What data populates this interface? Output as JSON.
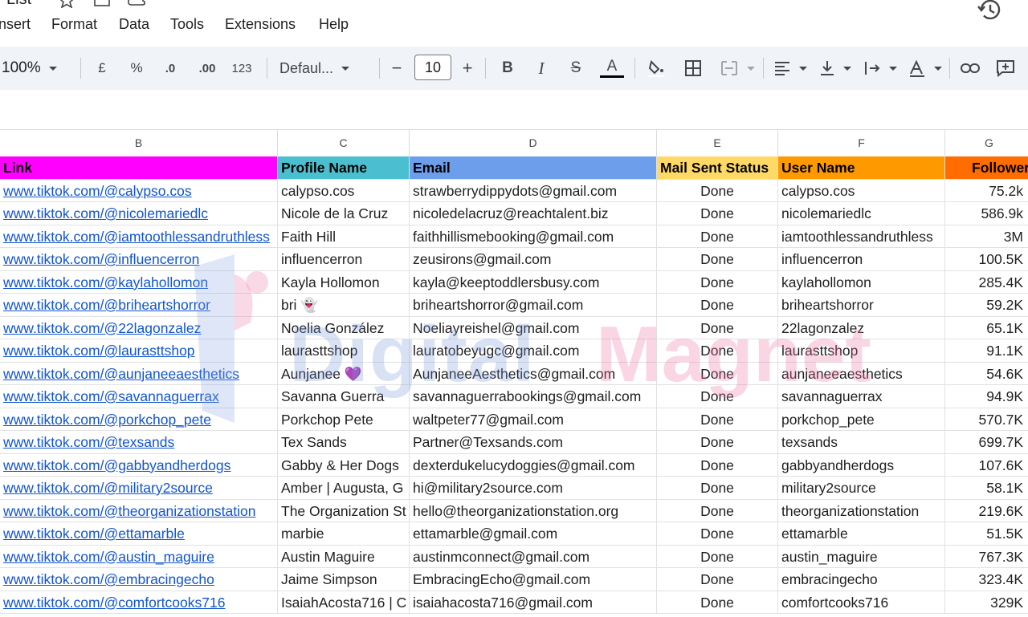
{
  "app": {
    "doc_title_fragment": "List"
  },
  "menu": [
    "nsert",
    "Format",
    "Data",
    "Tools",
    "Extensions",
    "Help"
  ],
  "toolbar": {
    "zoom": "100%",
    "currency": "£",
    "percent": "%",
    "dec_decrease": ".0",
    "dec_increase": ".00",
    "number_format": "123",
    "font": "Defaul...",
    "minus": "−",
    "font_size": "10",
    "plus": "+",
    "bold": "B",
    "italic": "I",
    "strike": "S",
    "text_color": "A"
  },
  "columns": [
    "B",
    "C",
    "D",
    "E",
    "F",
    "G"
  ],
  "header": {
    "link": "Link",
    "profile": "Profile Name",
    "email": "Email",
    "status": "Mail Sent Status",
    "user": "User Name",
    "followers": "Follower"
  },
  "header_colors": {
    "link": "#ff00ff",
    "profile": "#4bbfcf",
    "email": "#6d9eeb",
    "status": "#ffd966",
    "user": "#ff9900",
    "followers": "#ff6d01"
  },
  "rows": [
    {
      "link": "www.tiktok.com/@calypso.cos",
      "profile": "calypso.cos",
      "email": "strawberrydippydots@gmail.com",
      "status": "Done",
      "user": "calypso.cos",
      "followers": "75.2k"
    },
    {
      "link": "www.tiktok.com/@nicolemariedlc",
      "profile": "Nicole de la Cruz",
      "email": " nicoledelacruz@reachtalent.biz",
      "status": "Done",
      "user": "nicolemariedlc",
      "followers": "586.9k"
    },
    {
      "link": "www.tiktok.com/@iamtoothlessandruthless",
      "profile": "Faith Hill",
      "email": "faithhillismebooking@gmail.com",
      "status": "Done",
      "user": "iamtoothlessandruthless",
      "followers": "3M"
    },
    {
      "link": "www.tiktok.com/@influencerron",
      "profile": "influencerron",
      "email": "zeusirons@gmail.com",
      "status": "Done",
      "user": "influencerron",
      "followers": "100.5K"
    },
    {
      "link": "www.tiktok.com/@kaylahollomon",
      "profile": "Kayla Hollomon",
      "email": "kayla@keeptoddlersbusy.com",
      "status": "Done",
      "user": "kaylahollomon",
      "followers": "285.4K"
    },
    {
      "link": "www.tiktok.com/@briheartshorror",
      "profile": "bri 👻",
      "email": "briheartshorror@gmail.com",
      "status": "Done",
      "user": "briheartshorror",
      "followers": "59.2K"
    },
    {
      "link": "www.tiktok.com/@22lagonzalez",
      "profile": "Noelia González",
      "email": " Noeliayreishel@gmail.com",
      "status": "Done",
      "user": "22lagonzalez",
      "followers": "65.1K"
    },
    {
      "link": "www.tiktok.com/@laurasttshop",
      "profile": "laurasttshop",
      "email": "lauratobeyugc@gmail.com",
      "status": "Done",
      "user": "laurasttshop",
      "followers": "91.1K"
    },
    {
      "link": "www.tiktok.com/@aunjaneeaesthetics",
      "profile": "Aunjanee 💜",
      "email": "AunjaneeAesthetics@gmail.com",
      "status": "Done",
      "user": "aunjaneeaesthetics",
      "followers": "54.6K"
    },
    {
      "link": "www.tiktok.com/@savannaguerrax",
      "profile": "Savanna Guerra",
      "email": "savannaguerrabookings@gmail.com",
      "status": "Done",
      "user": "savannaguerrax",
      "followers": "94.9K"
    },
    {
      "link": "www.tiktok.com/@porkchop_pete",
      "profile": "Porkchop Pete",
      "email": "waltpeter77@gmail.com",
      "status": "Done",
      "user": "porkchop_pete",
      "followers": "570.7K"
    },
    {
      "link": "www.tiktok.com/@texsands",
      "profile": "Tex Sands",
      "email": " Partner@Texsands.com",
      "status": "Done",
      "user": "texsands",
      "followers": "699.7K"
    },
    {
      "link": "www.tiktok.com/@gabbyandherdogs",
      "profile": "Gabby & Her Dogs",
      "email": "dexterdukelucydoggies@gmail.com",
      "status": "Done",
      "user": "gabbyandherdogs",
      "followers": "107.6K"
    },
    {
      "link": "www.tiktok.com/@military2source",
      "profile": "Amber | Augusta, G",
      "email": "hi@military2source.com",
      "status": "Done",
      "user": "military2source",
      "followers": "58.1K"
    },
    {
      "link": "www.tiktok.com/@theorganizationstation",
      "profile": "The Organization St",
      "email": "hello@theorganizationstation.org",
      "status": "Done",
      "user": "theorganizationstation",
      "followers": "219.6K"
    },
    {
      "link": "www.tiktok.com/@ettamarble",
      "profile": "marbie",
      "email": "ettamarble@gmail.com",
      "status": "Done",
      "user": "ettamarble",
      "followers": "51.5K"
    },
    {
      "link": "www.tiktok.com/@austin_maguire",
      "profile": "Austin Maguire",
      "email": "austinmconnect@gmail.com",
      "status": "Done",
      "user": "austin_maguire",
      "followers": "767.3K"
    },
    {
      "link": "www.tiktok.com/@embracingecho",
      "profile": "Jaime Simpson",
      "email": "EmbracingEcho@gmail.com",
      "status": "Done",
      "user": "embracingecho",
      "followers": "323.4K"
    },
    {
      "link": "www.tiktok.com/@comfortcooks716",
      "profile": "IsaiahAcosta716 | C",
      "email": "isaiahacosta716@gmail.com",
      "status": "Done",
      "user": "comfortcooks716",
      "followers": "329K"
    }
  ],
  "watermark": {
    "word1": "Digital",
    "word2": "Magnet"
  }
}
